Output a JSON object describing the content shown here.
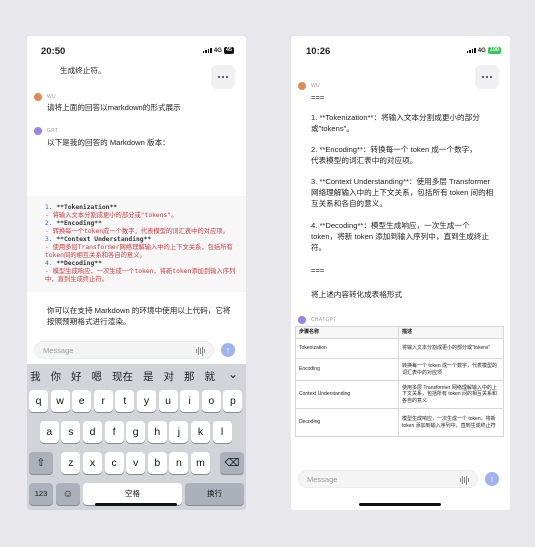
{
  "left": {
    "status": {
      "time": "20:50",
      "network": "4G",
      "battery": "45"
    },
    "top_text": "生成终止符。",
    "user": {
      "name": "WU",
      "message": "请将上面的回答以markdown的形式展示"
    },
    "gpt": {
      "name": "GPT",
      "intro": "以下是我的回答的 Markdown 版本：",
      "outro": "你可以在支持 Markdown 的环境中使用以上代码，它将按照预期格式进行渲染。"
    },
    "code_lines": [
      {
        "num": "1.",
        "strong": "**Tokenization**",
        "red": ""
      },
      {
        "num": "",
        "strong": "",
        "red": "   - 将输入文本分割成更小的部分或\"tokens\"。"
      },
      {
        "num": "2.",
        "strong": "**Encoding**",
        "red": ""
      },
      {
        "num": "",
        "strong": "",
        "red": "   - 转换每一个token成一个数字，代表模型的词汇表中的对应项。"
      },
      {
        "num": "3.",
        "strong": "**Context Understanding**",
        "red": ""
      },
      {
        "num": "",
        "strong": "",
        "red": "   - 使用多层Transformer网络理解输入中的上下文关系，包括所有token间的相互关系和各自的意义。"
      },
      {
        "num": "4.",
        "strong": "**Decoding**",
        "red": ""
      },
      {
        "num": "",
        "strong": "",
        "red": "   - 模型生成响应，一次生成一个token，将新token添加到输入序列中，直到生成终止符。"
      }
    ],
    "input_placeholder": "Message",
    "keyboard": {
      "suggestions": [
        "我",
        "你",
        "好",
        "嗯",
        "现在",
        "是",
        "对",
        "那",
        "就"
      ],
      "row1": [
        "q",
        "w",
        "e",
        "r",
        "t",
        "y",
        "u",
        "i",
        "o",
        "p"
      ],
      "row2": [
        "a",
        "s",
        "d",
        "f",
        "g",
        "h",
        "j",
        "k",
        "l"
      ],
      "row3": [
        "z",
        "x",
        "c",
        "v",
        "b",
        "n",
        "m"
      ],
      "num_key": "123",
      "space_key": "空格",
      "return_key": "换行",
      "chevron": "⌄",
      "shift": "⇧",
      "delete": "⌫",
      "emoji": "☺",
      "globe": "⊕"
    }
  },
  "right": {
    "status": {
      "time": "10:26",
      "network": "4G",
      "battery": "100"
    },
    "user": {
      "name": "WU",
      "lines": [
        "===",
        "1. **Tokenization**：将输入文本分割成更小的部分或\"tokens\"。",
        "2. **Encoding**：转换每一个 token 成一个数字，代表模型的词汇表中的对应项。",
        "3. **Context Understanding**：使用多层 Transformer 网络理解输入中的上下文关系，包括所有 token 间的相互关系和各自的意义。",
        "4. **Decoding**：模型生成响应，一次生成一个 token，将新 token 添加到输入序列中，直到生成终止符。",
        "===",
        "将上述内容转化成表格形式"
      ]
    },
    "gpt": {
      "name": "CHATGPT",
      "table": {
        "headers": [
          "步骤名称",
          "描述"
        ],
        "rows": [
          [
            "Tokenization",
            "将输入文本分割成更小的部分或\"tokens\""
          ],
          [
            "Encoding",
            "转换每一个 token 成一个数字，代表模型的词汇表中的对应项"
          ],
          [
            "Context Understanding",
            "使用多层 Transformer 网络理解输入中的上下文关系，包括所有 token 间的相互关系和各自的意义"
          ],
          [
            "Decoding",
            "模型生成响应，一次生成一个 token，将新 token 添加到输入序列中，直到生成终止符"
          ]
        ]
      }
    },
    "input_placeholder": "Message"
  },
  "colors": {
    "send_button": "#9fb3ee",
    "code_red": "#cc3b3b",
    "code_number": "#4a5bd0",
    "battery_full": "#34c759"
  }
}
